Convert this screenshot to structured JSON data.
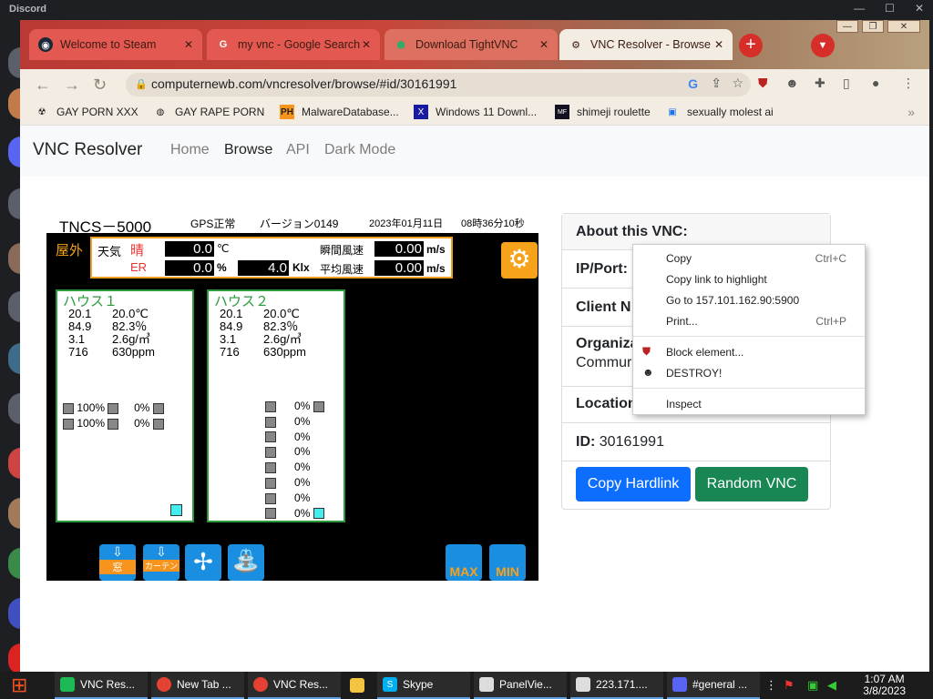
{
  "discord": {
    "title": "Discord"
  },
  "tabs": [
    {
      "label": "Welcome to Steam",
      "icon": "steam-icon"
    },
    {
      "label": "my vnc - Google Search",
      "icon": "google-icon"
    },
    {
      "label": "Download TightVNC",
      "icon": "tightvnc-icon"
    },
    {
      "label": "VNC Resolver - Browse",
      "icon": "vnc-resolver-icon"
    }
  ],
  "omnibox": {
    "url": "computernewb.com/vncresolver/browse/#id/30161991"
  },
  "bookmarks": [
    {
      "label": "GAY PORN XXX"
    },
    {
      "label": "GAY RAPE PORN"
    },
    {
      "label": "MalwareDatabase..."
    },
    {
      "label": "Windows 11 Downl..."
    },
    {
      "label": "shimeji roulette"
    },
    {
      "label": "sexually molest ai"
    }
  ],
  "site": {
    "brand": "VNC Resolver",
    "nav": [
      "Home",
      "Browse",
      "API",
      "Dark Mode"
    ]
  },
  "vnc": {
    "model": "TNCS－5000",
    "gps": "GPS正常",
    "version": "バージョン0149",
    "date": "2023年01月11日",
    "time": "08時36分10秒",
    "outdoor": "屋外",
    "weather_label": "天気",
    "weather_value": "晴",
    "er_label": "ER",
    "temp_value": "0.0",
    "temp_unit": "℃",
    "er_value": "0.0",
    "er_unit": "%",
    "lux_value": "4.0",
    "lux_unit": "Klx",
    "gust_label": "瞬間風速",
    "gust_value": "0.00",
    "gust_unit": "m/s",
    "avg_label": "平均風速",
    "avg_value": "0.00",
    "avg_unit": "m/s",
    "house1": {
      "title": "ハウス１",
      "rows": [
        [
          "20.1",
          "20.0℃"
        ],
        [
          "84.9",
          "82.3％"
        ],
        [
          "3.1",
          "2.6g/㎥"
        ],
        [
          "716",
          "630ppm"
        ]
      ],
      "vents": [
        [
          "100%",
          "0%"
        ],
        [
          "100%",
          "0%"
        ]
      ]
    },
    "house2": {
      "title": "ハウス２",
      "rows": [
        [
          "20.1",
          "20.0℃"
        ],
        [
          "82.3％",
          "84.9"
        ],
        [
          "3.1",
          "2.6g/㎥"
        ],
        [
          "716",
          "630ppm"
        ]
      ],
      "vents": [
        "0%",
        "0%",
        "0%",
        "0%",
        "0%",
        "0%",
        "0%",
        "0%"
      ]
    },
    "buttons": [
      "窓",
      "カーテン",
      "",
      "",
      "MAX",
      "MIN"
    ]
  },
  "about": {
    "header": "About this VNC:",
    "ip_label": "IP/Port:",
    "client_label": "Client N",
    "org_label": "Organiza",
    "org_value": "Commur",
    "location_label": "Location",
    "id_label": "ID:",
    "id_value": "30161991",
    "copy_button": "Copy Hardlink",
    "random_button": "Random VNC"
  },
  "context_menu": {
    "copy": "Copy",
    "copy_sc": "Ctrl+C",
    "copy_link": "Copy link to highlight",
    "goto": "Go to 157.101.162.90:5900",
    "print": "Print...",
    "print_sc": "Ctrl+P",
    "block": "Block element...",
    "destroy": "DESTROY!",
    "inspect": "Inspect"
  },
  "taskbar": {
    "items": [
      "VNC Res...",
      "New Tab ...",
      "VNC Res...",
      "",
      "Skype",
      "PanelVie...",
      "223.171....",
      "#general ..."
    ],
    "time": "1:07 AM",
    "date": "3/8/2023"
  }
}
